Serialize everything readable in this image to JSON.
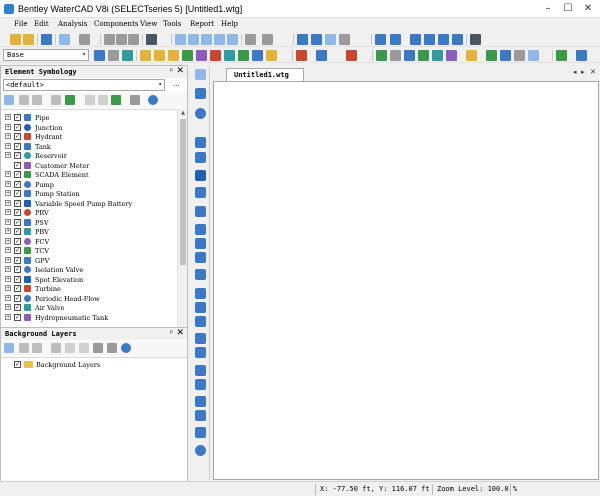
{
  "window": {
    "title": "Bentley WaterCAD V8i (SELECTseries 5) [Untitled1.wtg]",
    "minimize": "–",
    "maximize": "☐",
    "close": "✕"
  },
  "menu": [
    "File",
    "Edit",
    "Analysis",
    "Components",
    "View",
    "Tools",
    "Report",
    "Help"
  ],
  "toolbar": {
    "scenario_value": "Base",
    "scenario_arrow": "▾"
  },
  "element_symbology": {
    "title": "Element Symbology",
    "pin": "ᵖ",
    "close": "✕",
    "filter_value": "<default>",
    "filter_arrow": "▾",
    "filter_more": "...",
    "items": [
      "Pipe",
      "Junction",
      "Hydrant",
      "Tank",
      "Reservoir",
      "Customer Meter",
      "SCADA Element",
      "Pump",
      "Pump Station",
      "Variable Speed Pump Battery",
      "PRV",
      "PSV",
      "PBV",
      "FCV",
      "TCV",
      "GPV",
      "Isolation Valve",
      "Spot Elevation",
      "Turbine",
      "Periodic Head-Flow",
      "Air Valve",
      "Hydropneumatic Tank"
    ],
    "no_expander_items": [
      "Customer Meter"
    ],
    "scroll_up": "▲",
    "scroll_down": "▼"
  },
  "background_layers": {
    "title": "Background Layers",
    "pin": "ᵖ",
    "close": "✕",
    "root_item": "Background Layers"
  },
  "document": {
    "tab_label": "Untitled1.wtg",
    "nav_prev": "◂",
    "nav_next": "▸",
    "nav_close": "✕"
  },
  "status": {
    "coords": "X: -77.50 ft, Y: 116.07 ft",
    "zoom": "Zoom Level: 100.0 %"
  },
  "colors": {
    "accent_blue": "#3b78c6",
    "folder_yellow": "#e8c24a",
    "canvas_white": "#ffffff"
  },
  "icons": {
    "expander": "+",
    "checkmark": "✓"
  }
}
